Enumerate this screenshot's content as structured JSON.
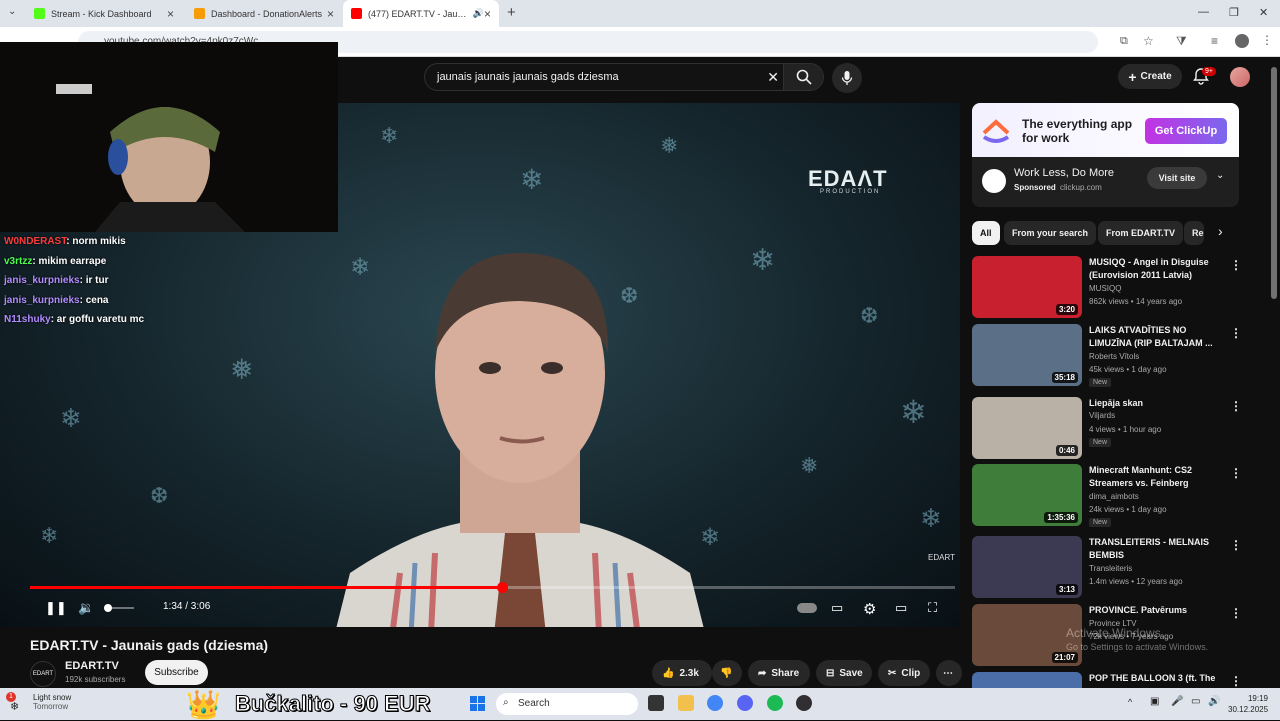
{
  "browser": {
    "tabs": [
      {
        "title": "Stream - Kick Dashboard",
        "color": "#53fc18"
      },
      {
        "title": "Dashboard - DonationAlerts",
        "color": "#f59c07"
      },
      {
        "title": "(477) EDART.TV - Jaunais gads",
        "color": "#ff0000"
      }
    ],
    "url": "youtube.com/watch?v=4pk0z7cWc"
  },
  "youtube": {
    "search_query": "jaunais jaunais jaunais gads dziesma",
    "create_label": "Create",
    "notif_badge": "9+",
    "player": {
      "brand_logo": "EDAɅT",
      "brand_sub": "PRODUCTION",
      "watermark": "EDART",
      "time": "1:34 / 3:06",
      "progress_fraction": 0.51
    },
    "video": {
      "title": "EDART.TV - Jaunais gads (dziesma)",
      "channel_avatar": "EDART",
      "channel": "EDART.TV",
      "subscribers": "192k subscribers",
      "subscribe_label": "Subscribe",
      "likes": "2.3k",
      "share_label": "Share",
      "save_label": "Save",
      "clip_label": "Clip"
    },
    "ad": {
      "headline": "The everything app for work",
      "cta": "Get ClickUp",
      "title": "Work Less, Do More",
      "sponsored": "Sponsored",
      "domain": "clickup.com",
      "visit_label": "Visit site"
    },
    "chips": [
      "All",
      "From your search",
      "From EDART.TV",
      "Re"
    ],
    "recommendations": [
      {
        "title": "MUSIQQ - Angel in Disguise (Eurovision 2011 Latvia) Offici...",
        "channel": "MUSIQQ",
        "meta": "862k views • 14 years ago",
        "duration": "3:20",
        "badge": "",
        "thumb": "#c8202e"
      },
      {
        "title": "LAIKS ATVADĪTIES NO LIMUZĪNA (RIP BALTAJAM ...",
        "channel": "Roberts Vītols",
        "meta": "45k views • 1 day ago",
        "duration": "35:18",
        "badge": "New",
        "thumb": "#5b6f86"
      },
      {
        "title": "Liepāja skan",
        "channel": "Viljards",
        "meta": "4 views • 1 hour ago",
        "duration": "0:46",
        "badge": "New",
        "thumb": "#b9b1a6"
      },
      {
        "title": "Minecraft Manhunt: CS2 Streamers vs. Feinberg",
        "channel": "dima_aimbots",
        "meta": "24k views • 1 day ago",
        "duration": "1:35:36",
        "badge": "New",
        "thumb": "#3f7d3a"
      },
      {
        "title": "TRANSLEITERIS - MELNAIS BEMBIS",
        "channel": "Transleiteris",
        "meta": "1.4m views • 12 years ago",
        "duration": "3:13",
        "badge": "",
        "thumb": "#3b3a52"
      },
      {
        "title": "PROVINCE. Patvērums",
        "channel": "Province LTV",
        "meta": "72k views • 7 years ago",
        "duration": "21:07",
        "badge": "",
        "thumb": "#6a4a3a"
      },
      {
        "title": "POP THE BALLOON 3 (ft. The",
        "channel": "",
        "meta": "",
        "duration": "",
        "badge": "",
        "thumb": "#4b6ea8"
      }
    ],
    "activate": {
      "line1": "Activate Windows",
      "line2": "Go to Settings to activate Windows."
    }
  },
  "stream_overlay": {
    "chat": [
      {
        "user": "W0NDERAST",
        "text": ": norm mikis",
        "color": "#ff3b3b"
      },
      {
        "user": "v3rtzz",
        "text": ": mikim earrape",
        "color": "#4cff4c"
      },
      {
        "user": "janis_kurpnieks",
        "text": ": ir tur",
        "color": "#b28cff"
      },
      {
        "user": "janis_kurpnieks",
        "text": ": cena",
        "color": "#b28cff"
      },
      {
        "user": "N11shuky",
        "text": ": ar goffu varetu mc",
        "color": "#b28cff"
      }
    ]
  },
  "taskbar": {
    "weather_title": "Light snow",
    "weather_sub": "Tomorrow",
    "weather_badge": "1",
    "donation_text": "Bučkalito - 90 EUR",
    "search_placeholder": "Search",
    "time": "19:19",
    "date": "30.12.2025"
  }
}
